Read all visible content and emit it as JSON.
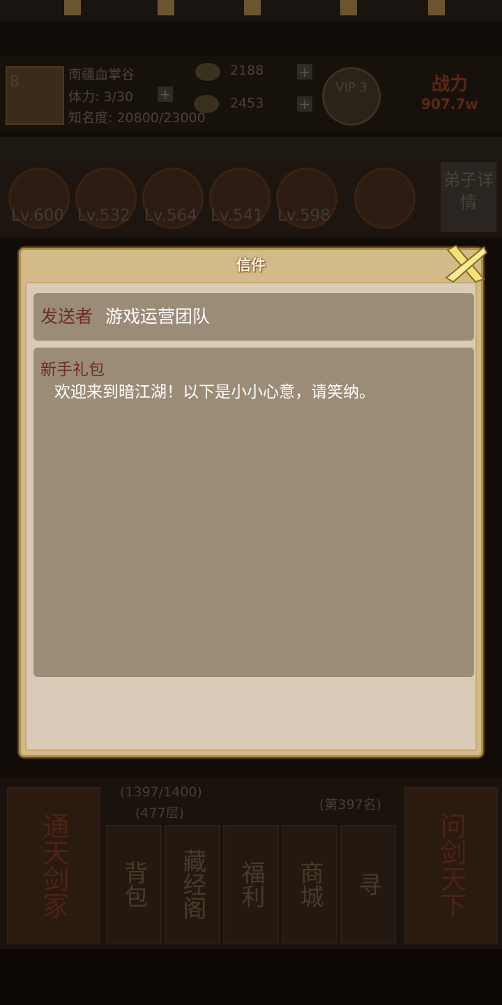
{
  "background": {
    "sect_name": "南疆血掌谷",
    "stamina": "体力: 3/30",
    "fame": "知名度: 20800/23000",
    "level_badge": "8",
    "silver": "2188",
    "gold": "2453",
    "vip": "VIP 3",
    "power_label": "战力",
    "power_value": "907.7w",
    "hero_levels": [
      "Lv.600",
      "Lv.532",
      "Lv.564",
      "Lv.541",
      "Lv.598"
    ],
    "disciple_detail": "弟子详情",
    "tower_progress": "(1397/1400)",
    "tower_floor": "(477层)",
    "rank": "(第397名)",
    "left_big_button": "通天剑冢",
    "right_big_button": "问剑天下",
    "small_buttons": [
      "背包",
      "藏经阁",
      "福利",
      "商城",
      "寻"
    ]
  },
  "dialog": {
    "title": "信件",
    "sender_label": "发送者",
    "sender_value": "游戏运营团队",
    "subject": "新手礼包",
    "body": "欢迎来到暗江湖！以下是小小心意，请笑纳。"
  },
  "colors": {
    "dialog_frame": "#d2bb88",
    "dialog_inner": "#d9cbb7",
    "text_box": "#9b8c78",
    "label_red": "#6b2e22"
  }
}
